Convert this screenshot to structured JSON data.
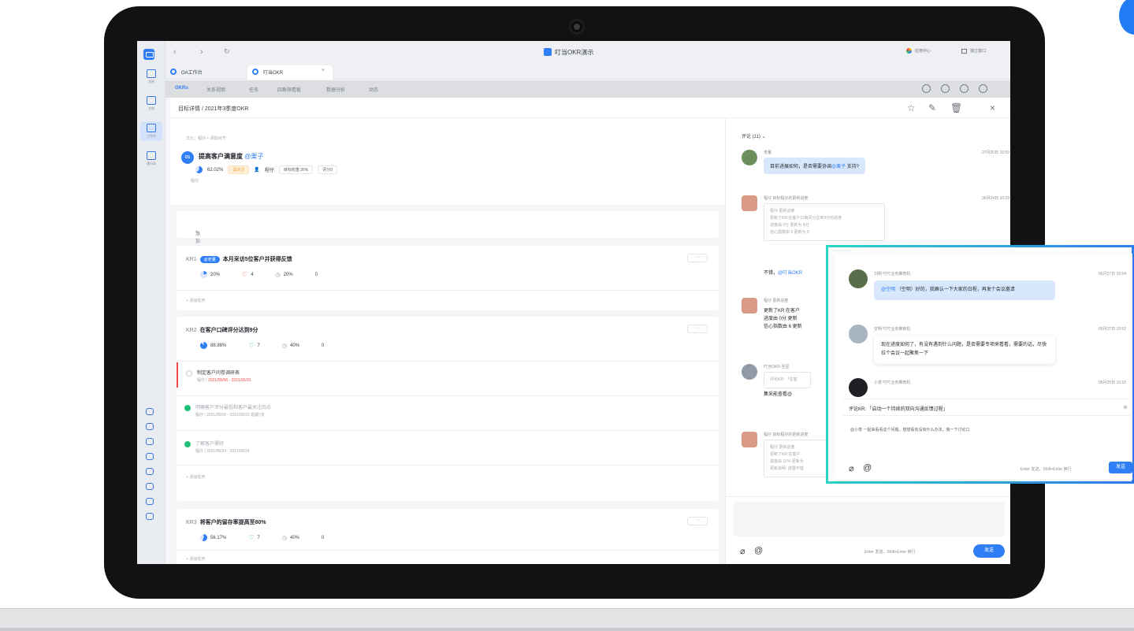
{
  "browser": {
    "window_title": "叮当OKR演示",
    "app_center": "应用中心",
    "standalone_window": "独立窗口",
    "tabs": [
      {
        "label": "OA工作台"
      },
      {
        "label": "叮当OKR",
        "active": true
      }
    ]
  },
  "rail": {
    "items": [
      {
        "label": "消息"
      },
      {
        "label": "文档"
      },
      {
        "label": "工作台",
        "active": true
      },
      {
        "label": "通讯录"
      }
    ]
  },
  "menu": {
    "items": [
      "OKRs",
      "关系视图",
      "任务",
      "四象限看板",
      "数据分析",
      "动态"
    ],
    "active": "OKRs"
  },
  "header": {
    "breadcrumb": "目标详情 / 2021年3季度OKR"
  },
  "objective": {
    "meta": "文七、程仔  + 添加对齐",
    "avatar": "O1",
    "title": "提高客户满意度",
    "mention": "@栗子",
    "progress": "62.02%",
    "status": "需关注",
    "owner": "程仔",
    "weight": "目标权重:30%",
    "score": "评分0",
    "sub": "程仔"
  },
  "add_key_result": "添加关键结果",
  "key_results": [
    {
      "no": "KR1",
      "tag": "@老董",
      "title": "本月采访5位客户并获得反馈",
      "progress": "20%",
      "likes": "4",
      "weight": "20%",
      "score": "0",
      "add_task": "添加任务"
    },
    {
      "no": "KR2",
      "title": "在客户口碑评分达到9分",
      "progress": "88.88%",
      "likes": "7",
      "weight": "40%",
      "score": "0",
      "tasks": [
        {
          "title": "制定客户问卷调研表",
          "owner": "程仔",
          "date": "2021/05/06 - 2021/05/31",
          "late": true
        },
        {
          "title": "明确客户评分最低和客户最关注的点",
          "owner": "程仔",
          "date": "2021/05/06 - 2021/05/31 逾期7天",
          "done": true
        },
        {
          "title": "了解客户需好",
          "owner": "程仔",
          "date": "2021/06/24 - 2021/06/24",
          "done": true
        }
      ],
      "add_task": "添加任务"
    },
    {
      "no": "KR3",
      "title": "将客户的留存率提高至80%",
      "progress": "56.17%",
      "likes": "7",
      "weight": "40%",
      "score": "0",
      "add_task": "添加任务"
    }
  ],
  "comments": {
    "header": "评论 (11)",
    "items": [
      {
        "name": "老董",
        "time": "07月20日 16:59",
        "text": "目前进展如何，是否需要协调",
        "mention": "@栗子",
        "text_end": "支持?"
      },
      {
        "name": "程仔 目标程仔的更新进度",
        "time": "06月24日 16:29",
        "box": [
          "程仔 更新进度",
          "更新了KR:在客户口碑评分达到9分的进度",
          "进度由 0分 更新为 8分",
          "信心指数由 5 更新为 5"
        ],
        "text": "不错，",
        "mention": "@叮当OKR"
      },
      {
        "name": "程仔 更新进度",
        "text": "更新了KR:在客户",
        "text2": "进度由 0分 更新",
        "text3": "信心指数由 6 更新"
      },
      {
        "name": "叮当OKR-至星",
        "box": [
          "评论KR: 「在客"
        ],
        "text": "集采能查看@"
      },
      {
        "name": "程仔 目标程仔的更新进度",
        "box": [
          "程仔 更新进度",
          "更新了KR:在客户",
          "进度由 10% 更新为",
          "更新说明: 进展不错"
        ]
      }
    ],
    "composer_hint": "Enter 发送，Shift+Enter 换行",
    "send": "发送"
  },
  "highlight": {
    "items": [
      {
        "name": "刘刚 叮叮业务推荐机",
        "time": "05月27日 15:54",
        "mention": "@空明",
        "text": "（空明）好的，我确认一下大家的日程，再发个会议邀请"
      },
      {
        "name": "空明 叮叮业务推荐机",
        "time": "05月27日 15:52",
        "text": "现在进度如何了，有没有遇到什么问题，是否需要专项来看看，需要的话，尽快拉个会议一起聚焦一下"
      },
      {
        "name": "小茶 叮叮业务推荐机",
        "time": "05月25日 10:16"
      }
    ],
    "reply_target": "评论KR: 「启动一个持续的双向沟通反馈过程」",
    "input_text": "@小茶 一起来看看这个问题，想想看有没有什么办法，我一下讨论口",
    "hint": "Enter 发送，Shift+Enter 换行",
    "send": "发送"
  },
  "colors": {
    "accent": "#2f7ef5",
    "warning": "#f2a33a",
    "danger": "#f54a45",
    "success": "#24c07a",
    "highlight_border_start": "#2bd4c6"
  }
}
